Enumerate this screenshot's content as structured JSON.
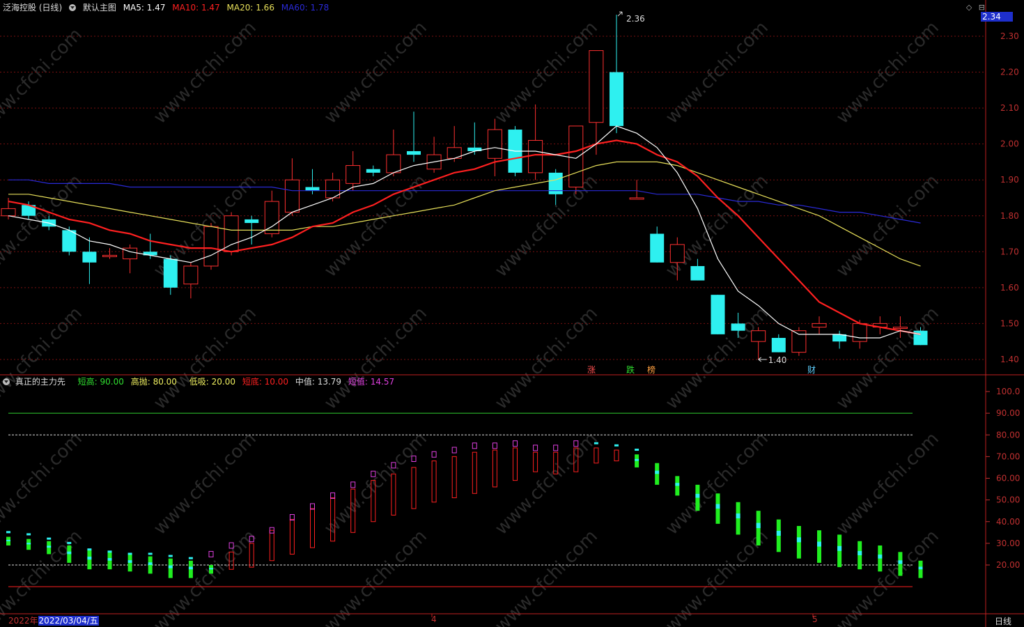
{
  "header": {
    "title": "泛海控股 (日线)",
    "chart_name": "默认主图",
    "ma5": "MA5: 1.47",
    "ma10": "MA10: 1.47",
    "ma20": "MA20: 1.66",
    "ma60": "MA60: 1.78",
    "current_price": "2.34"
  },
  "indicator": {
    "name": "真正的主力先",
    "short_high": "短高: 90.00",
    "high_sell": "高抛: 80.00",
    "low_buy": "低吸: 20.00",
    "short_bottom": "短底: 10.00",
    "mid": "中值: 13.79",
    "short_val": "短值: 14.57"
  },
  "footer": {
    "year": "2022年",
    "date": "2022/03/04/五",
    "month4": "4",
    "month5": "5",
    "period": "日线"
  },
  "events": {
    "zhang": "涨",
    "die": "跌",
    "bang": "榜",
    "cai": "财"
  },
  "annotations": {
    "high": "2.36",
    "low": "1.40"
  },
  "watermark": "www.cfchi.com",
  "colors": {
    "up": "#ff3030",
    "down": "#2ef0f0",
    "ma5": "#ffffff",
    "ma10": "#ff2020",
    "ma20": "#e8e05a",
    "ma60": "#2a2ad8",
    "grid": "#7a1010"
  },
  "chart_data": [
    {
      "type": "candlestick",
      "title": "泛海控股 (日线)",
      "ylim": [
        1.36,
        2.38
      ],
      "yticks": [
        "2.30",
        "2.20",
        "2.10",
        "2.00",
        "1.90",
        "1.80",
        "1.70",
        "1.60",
        "1.50",
        "1.40"
      ],
      "candles": [
        {
          "o": 1.8,
          "h": 1.85,
          "l": 1.79,
          "c": 1.82
        },
        {
          "o": 1.83,
          "h": 1.84,
          "l": 1.79,
          "c": 1.8
        },
        {
          "o": 1.79,
          "h": 1.8,
          "l": 1.76,
          "c": 1.77
        },
        {
          "o": 1.76,
          "h": 1.77,
          "l": 1.69,
          "c": 1.7
        },
        {
          "o": 1.7,
          "h": 1.74,
          "l": 1.61,
          "c": 1.67
        },
        {
          "o": 1.69,
          "h": 1.71,
          "l": 1.68,
          "c": 1.69
        },
        {
          "o": 1.68,
          "h": 1.72,
          "l": 1.64,
          "c": 1.71
        },
        {
          "o": 1.7,
          "h": 1.75,
          "l": 1.68,
          "c": 1.69
        },
        {
          "o": 1.68,
          "h": 1.69,
          "l": 1.58,
          "c": 1.6
        },
        {
          "o": 1.61,
          "h": 1.67,
          "l": 1.57,
          "c": 1.66
        },
        {
          "o": 1.66,
          "h": 1.78,
          "l": 1.65,
          "c": 1.77
        },
        {
          "o": 1.7,
          "h": 1.81,
          "l": 1.69,
          "c": 1.8
        },
        {
          "o": 1.79,
          "h": 1.8,
          "l": 1.72,
          "c": 1.78
        },
        {
          "o": 1.75,
          "h": 1.87,
          "l": 1.74,
          "c": 1.84
        },
        {
          "o": 1.81,
          "h": 1.96,
          "l": 1.8,
          "c": 1.9
        },
        {
          "o": 1.88,
          "h": 1.93,
          "l": 1.86,
          "c": 1.87
        },
        {
          "o": 1.85,
          "h": 1.92,
          "l": 1.84,
          "c": 1.9
        },
        {
          "o": 1.89,
          "h": 1.98,
          "l": 1.87,
          "c": 1.94
        },
        {
          "o": 1.93,
          "h": 1.94,
          "l": 1.91,
          "c": 1.92
        },
        {
          "o": 1.92,
          "h": 2.04,
          "l": 1.91,
          "c": 1.97
        },
        {
          "o": 1.98,
          "h": 2.09,
          "l": 1.95,
          "c": 1.97
        },
        {
          "o": 1.93,
          "h": 2.02,
          "l": 1.92,
          "c": 1.97
        },
        {
          "o": 1.96,
          "h": 2.05,
          "l": 1.95,
          "c": 1.99
        },
        {
          "o": 1.99,
          "h": 2.06,
          "l": 1.97,
          "c": 1.98
        },
        {
          "o": 1.96,
          "h": 2.07,
          "l": 1.91,
          "c": 2.04
        },
        {
          "o": 2.04,
          "h": 2.05,
          "l": 1.91,
          "c": 1.92
        },
        {
          "o": 1.92,
          "h": 2.11,
          "l": 1.9,
          "c": 2.01
        },
        {
          "o": 1.92,
          "h": 1.93,
          "l": 1.83,
          "c": 1.86
        },
        {
          "o": 1.88,
          "h": 2.05,
          "l": 1.86,
          "c": 2.05
        },
        {
          "o": 2.06,
          "h": 2.26,
          "l": 1.97,
          "c": 2.26
        },
        {
          "o": 2.2,
          "h": 2.36,
          "l": 2.03,
          "c": 2.05
        },
        {
          "o": 1.85,
          "h": 1.9,
          "l": 1.85,
          "c": 1.85
        },
        {
          "o": 1.75,
          "h": 1.77,
          "l": 1.67,
          "c": 1.67
        },
        {
          "o": 1.67,
          "h": 1.74,
          "l": 1.62,
          "c": 1.72
        },
        {
          "o": 1.66,
          "h": 1.68,
          "l": 1.62,
          "c": 1.62
        },
        {
          "o": 1.58,
          "h": 1.58,
          "l": 1.47,
          "c": 1.47
        },
        {
          "o": 1.5,
          "h": 1.53,
          "l": 1.46,
          "c": 1.48
        },
        {
          "o": 1.45,
          "h": 1.49,
          "l": 1.4,
          "c": 1.48
        },
        {
          "o": 1.46,
          "h": 1.47,
          "l": 1.42,
          "c": 1.42
        },
        {
          "o": 1.42,
          "h": 1.49,
          "l": 1.41,
          "c": 1.48
        },
        {
          "o": 1.49,
          "h": 1.52,
          "l": 1.47,
          "c": 1.5
        },
        {
          "o": 1.47,
          "h": 1.48,
          "l": 1.43,
          "c": 1.45
        },
        {
          "o": 1.45,
          "h": 1.51,
          "l": 1.43,
          "c": 1.5
        },
        {
          "o": 1.49,
          "h": 1.52,
          "l": 1.47,
          "c": 1.5
        },
        {
          "o": 1.49,
          "h": 1.52,
          "l": 1.46,
          "c": 1.49
        },
        {
          "o": 1.48,
          "h": 1.49,
          "l": 1.44,
          "c": 1.44
        }
      ],
      "ma5": [
        1.8,
        1.79,
        1.78,
        1.76,
        1.73,
        1.72,
        1.7,
        1.69,
        1.68,
        1.67,
        1.69,
        1.72,
        1.74,
        1.77,
        1.81,
        1.83,
        1.85,
        1.88,
        1.89,
        1.92,
        1.94,
        1.95,
        1.96,
        1.98,
        1.99,
        1.98,
        1.98,
        1.97,
        1.96,
        2.0,
        2.05,
        2.03,
        1.99,
        1.92,
        1.82,
        1.68,
        1.59,
        1.55,
        1.5,
        1.47,
        1.47,
        1.47,
        1.46,
        1.46,
        1.48,
        1.47
      ],
      "ma10": [
        1.84,
        1.83,
        1.81,
        1.79,
        1.78,
        1.76,
        1.75,
        1.73,
        1.72,
        1.71,
        1.71,
        1.7,
        1.71,
        1.72,
        1.74,
        1.77,
        1.78,
        1.81,
        1.83,
        1.86,
        1.88,
        1.9,
        1.92,
        1.93,
        1.95,
        1.96,
        1.97,
        1.97,
        1.98,
        2.0,
        2.01,
        2.0,
        1.97,
        1.95,
        1.91,
        1.85,
        1.8,
        1.74,
        1.68,
        1.62,
        1.56,
        1.53,
        1.5,
        1.49,
        1.48,
        1.47
      ],
      "ma20": [
        1.86,
        1.86,
        1.85,
        1.84,
        1.83,
        1.82,
        1.81,
        1.8,
        1.79,
        1.78,
        1.77,
        1.76,
        1.76,
        1.76,
        1.76,
        1.77,
        1.77,
        1.78,
        1.79,
        1.8,
        1.81,
        1.82,
        1.83,
        1.85,
        1.87,
        1.88,
        1.89,
        1.9,
        1.92,
        1.94,
        1.95,
        1.95,
        1.95,
        1.94,
        1.92,
        1.9,
        1.88,
        1.86,
        1.84,
        1.82,
        1.8,
        1.77,
        1.74,
        1.71,
        1.68,
        1.66
      ],
      "ma60": [
        1.9,
        1.9,
        1.89,
        1.89,
        1.89,
        1.89,
        1.88,
        1.88,
        1.88,
        1.88,
        1.88,
        1.88,
        1.88,
        1.88,
        1.87,
        1.87,
        1.87,
        1.87,
        1.87,
        1.87,
        1.87,
        1.87,
        1.87,
        1.87,
        1.87,
        1.87,
        1.87,
        1.87,
        1.87,
        1.87,
        1.87,
        1.87,
        1.86,
        1.86,
        1.86,
        1.85,
        1.84,
        1.84,
        1.83,
        1.83,
        1.82,
        1.81,
        1.81,
        1.8,
        1.79,
        1.78
      ]
    },
    {
      "type": "bar",
      "title": "真正的主力先",
      "ylim": [
        0,
        105
      ],
      "yticks": [
        "100.0",
        "90.00",
        "80.00",
        "70.00",
        "60.00",
        "50.00",
        "40.00",
        "30.00",
        "20.00"
      ],
      "levels": {
        "short_high": 90,
        "high_sell": 80,
        "low_buy": 20,
        "short_bottom": 10
      },
      "bars": [
        {
          "a": 33,
          "b": 29,
          "kind": "g"
        },
        {
          "a": 32,
          "b": 27,
          "kind": "g"
        },
        {
          "a": 31,
          "b": 25,
          "kind": "g"
        },
        {
          "a": 29,
          "b": 21,
          "kind": "g"
        },
        {
          "a": 27,
          "b": 18,
          "kind": "g"
        },
        {
          "a": 26,
          "b": 18,
          "kind": "g"
        },
        {
          "a": 25,
          "b": 17,
          "kind": "g"
        },
        {
          "a": 24,
          "b": 16,
          "kind": "g"
        },
        {
          "a": 23,
          "b": 14,
          "kind": "g"
        },
        {
          "a": 22,
          "b": 14,
          "kind": "g"
        },
        {
          "a": 20,
          "b": 16,
          "kind": "g"
        },
        {
          "a": 26,
          "b": 18,
          "kind": "r"
        },
        {
          "a": 30,
          "b": 19,
          "kind": "r"
        },
        {
          "a": 36,
          "b": 22,
          "kind": "r"
        },
        {
          "a": 41,
          "b": 25,
          "kind": "r"
        },
        {
          "a": 46,
          "b": 28,
          "kind": "r"
        },
        {
          "a": 51,
          "b": 31,
          "kind": "r"
        },
        {
          "a": 55,
          "b": 35,
          "kind": "r"
        },
        {
          "a": 59,
          "b": 40,
          "kind": "r"
        },
        {
          "a": 62,
          "b": 43,
          "kind": "r"
        },
        {
          "a": 65,
          "b": 46,
          "kind": "r"
        },
        {
          "a": 68,
          "b": 49,
          "kind": "r"
        },
        {
          "a": 70,
          "b": 51,
          "kind": "r"
        },
        {
          "a": 72,
          "b": 53,
          "kind": "r"
        },
        {
          "a": 73,
          "b": 56,
          "kind": "r"
        },
        {
          "a": 74,
          "b": 59,
          "kind": "r"
        },
        {
          "a": 72,
          "b": 63,
          "kind": "r"
        },
        {
          "a": 72,
          "b": 62,
          "kind": "r"
        },
        {
          "a": 74,
          "b": 63,
          "kind": "r"
        },
        {
          "a": 74,
          "b": 67,
          "kind": "r"
        },
        {
          "a": 73,
          "b": 68,
          "kind": "r"
        },
        {
          "a": 71,
          "b": 65,
          "kind": "g"
        },
        {
          "a": 67,
          "b": 57,
          "kind": "g"
        },
        {
          "a": 61,
          "b": 52,
          "kind": "g"
        },
        {
          "a": 57,
          "b": 45,
          "kind": "g"
        },
        {
          "a": 53,
          "b": 39,
          "kind": "g"
        },
        {
          "a": 49,
          "b": 34,
          "kind": "g"
        },
        {
          "a": 45,
          "b": 29,
          "kind": "g"
        },
        {
          "a": 41,
          "b": 26,
          "kind": "g"
        },
        {
          "a": 38,
          "b": 23,
          "kind": "g"
        },
        {
          "a": 36,
          "b": 21,
          "kind": "g"
        },
        {
          "a": 34,
          "b": 19,
          "kind": "g"
        },
        {
          "a": 31,
          "b": 18,
          "kind": "g"
        },
        {
          "a": 29,
          "b": 17,
          "kind": "g"
        },
        {
          "a": 26,
          "b": 15,
          "kind": "g"
        },
        {
          "a": 22,
          "b": 14,
          "kind": "g"
        }
      ],
      "marks": [
        33,
        32,
        30,
        28,
        25,
        24,
        23,
        23,
        22,
        21,
        23,
        27,
        30,
        34,
        40,
        45,
        50,
        55,
        60,
        64,
        67,
        69,
        71,
        73,
        73,
        74,
        72,
        72,
        74,
        74,
        73,
        71
      ]
    }
  ]
}
